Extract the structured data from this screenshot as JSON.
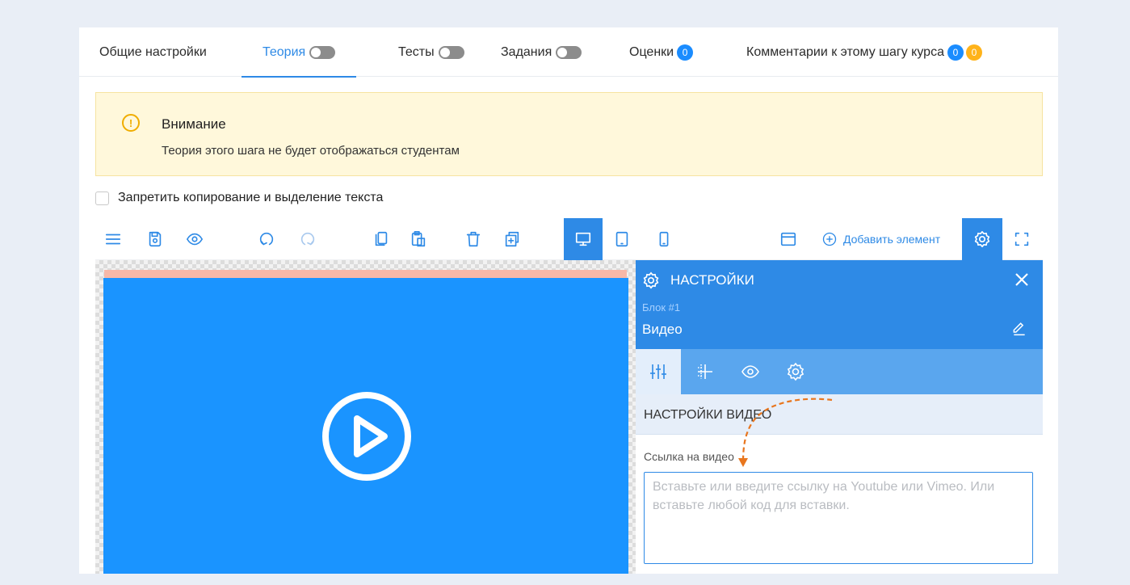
{
  "tabs": [
    {
      "label": "Общие настройки"
    },
    {
      "label": "Теория",
      "active": true,
      "toggle": "off"
    },
    {
      "label": "Тесты",
      "toggle": "off"
    },
    {
      "label": "Задания",
      "toggle": "off"
    },
    {
      "label": "Оценки",
      "badge": "0"
    },
    {
      "label": "Комментарии к этому шагу курса",
      "badge_blue": "0",
      "badge_orange": "0"
    }
  ],
  "alert": {
    "title": "Внимание",
    "text": "Теория этого шага не будет отображаться студентам"
  },
  "copy_protect": {
    "label": "Запретить копирование и выделение текста",
    "checked": false
  },
  "toolbar": {
    "add_element_label": "Добавить элемент",
    "icons": [
      "menu-icon",
      "save-icon",
      "preview-eye-icon",
      "undo-icon",
      "redo-icon",
      "copy-icon",
      "paste-icon",
      "delete-icon",
      "duplicate-icon",
      "desktop-icon",
      "tablet-icon",
      "mobile-icon",
      "window-icon",
      "plus-circle-icon",
      "settings-gear-icon",
      "fullscreen-icon"
    ]
  },
  "panel": {
    "title": "НАСТРОЙКИ",
    "block_label": "Блок #1",
    "block_name": "Видео",
    "section_title": "НАСТРОЙКИ ВИДЕО",
    "field_label": "Ссылка на видео",
    "field_placeholder": "Вставьте или введите ссылку на Youtube или Vimeo. Или вставьте любой код для вставки.",
    "field_value": ""
  },
  "colors": {
    "accent": "#2e8ae6",
    "video_bg": "#1a94ff",
    "alert_bg": "#fff8db",
    "badge_orange": "#ffb31a",
    "arrow": "#e8761e"
  }
}
